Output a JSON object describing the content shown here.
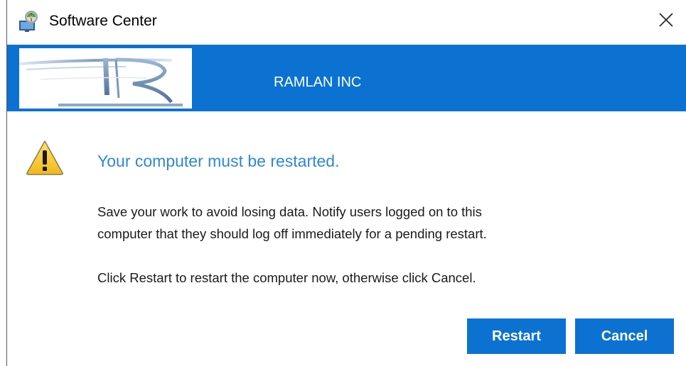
{
  "window": {
    "title": "Software Center",
    "app_icon": "software-center-icon",
    "close_icon": "close-icon"
  },
  "banner": {
    "organization_name": "RAMLAN INC",
    "logo": "company-logo",
    "background_color": "#0b72d2"
  },
  "dialog": {
    "icon": "warning-icon",
    "heading": "Your computer must be restarted.",
    "message_line1": "Save your work to avoid losing data. Notify users logged on to this",
    "message_line2": "computer that they should log off immediately for a pending restart.",
    "instruction": "Click Restart to restart the computer now, otherwise click Cancel.",
    "heading_color": "#2e88d6"
  },
  "buttons": {
    "restart_label": "Restart",
    "cancel_label": "Cancel",
    "button_color": "#0b72d2"
  }
}
